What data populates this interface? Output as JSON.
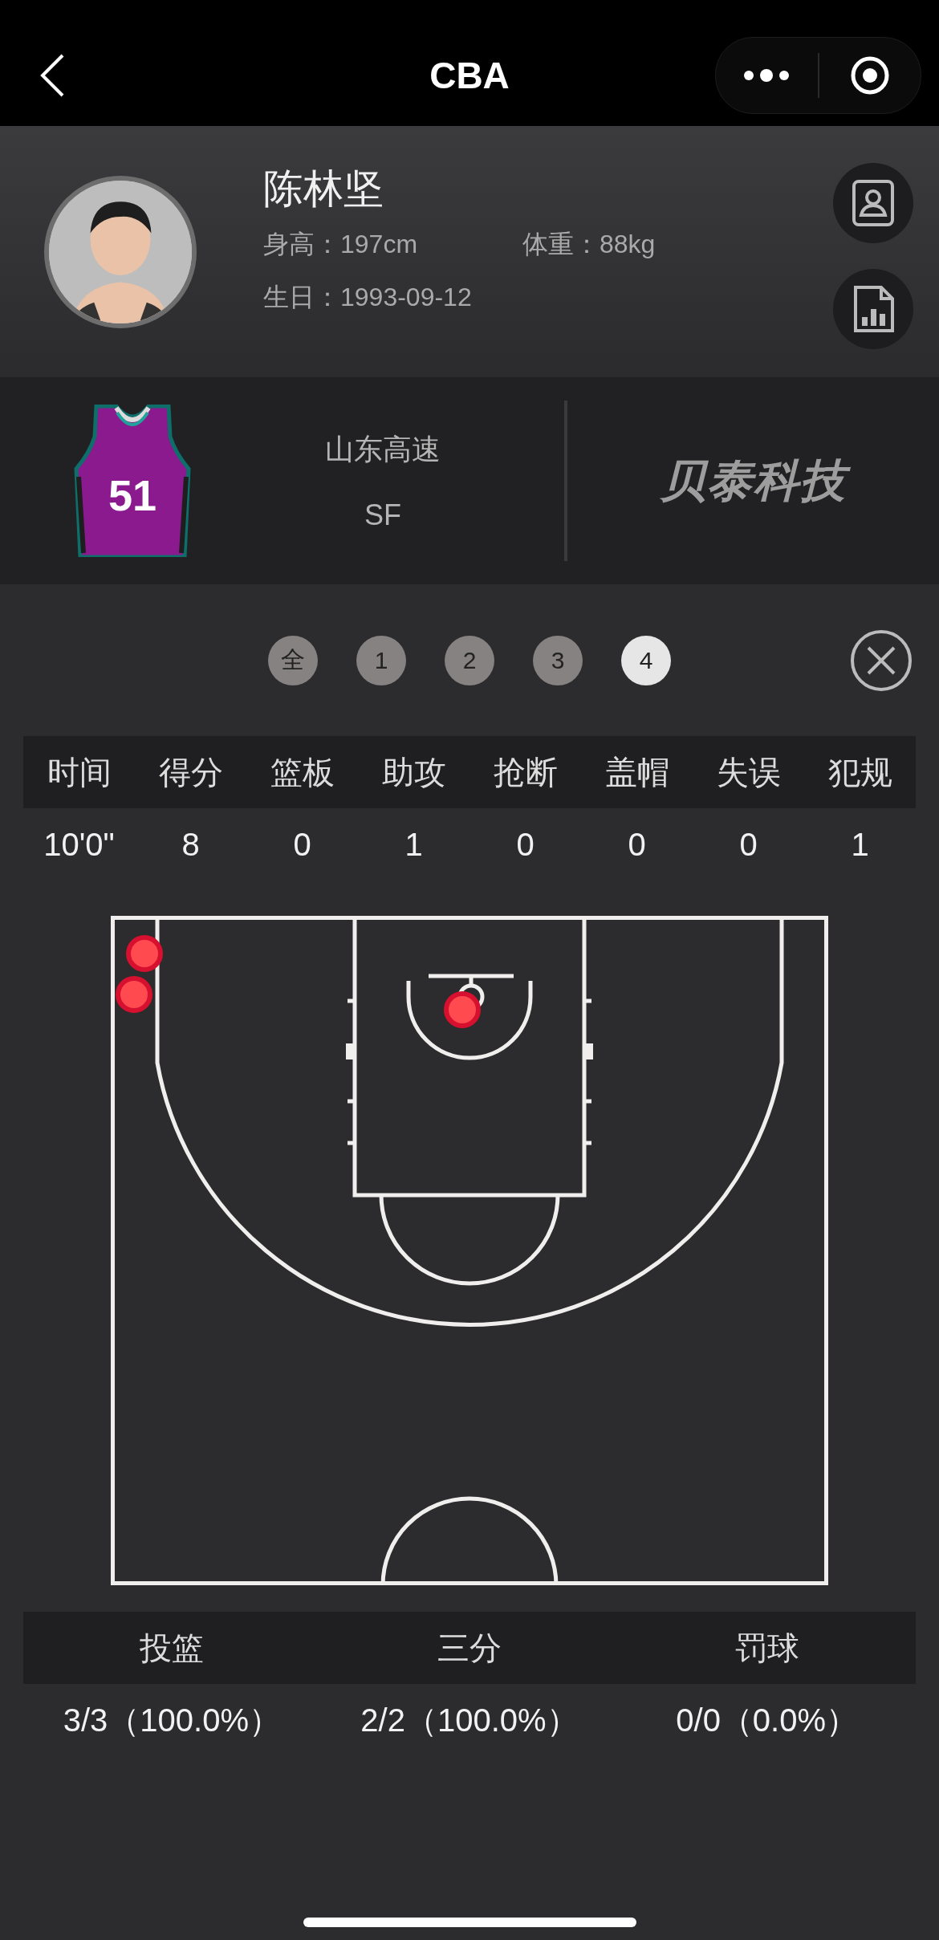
{
  "nav": {
    "title": "CBA"
  },
  "player": {
    "name": "陈林坚",
    "height": "身高：197cm",
    "weight": "体重：88kg",
    "birthday": "生日：1993-09-12"
  },
  "team": {
    "jersey_number": "51",
    "name": "山东高速",
    "position": "SF"
  },
  "sponsor": "贝泰科技",
  "periods": [
    {
      "label": "全",
      "selected": false
    },
    {
      "label": "1",
      "selected": false
    },
    {
      "label": "2",
      "selected": false
    },
    {
      "label": "3",
      "selected": false
    },
    {
      "label": "4",
      "selected": true
    }
  ],
  "stats": {
    "columns": [
      "时间",
      "得分",
      "篮板",
      "助攻",
      "抢断",
      "盖帽",
      "失误",
      "犯规"
    ],
    "values": [
      "10'0\"",
      "8",
      "0",
      "1",
      "0",
      "0",
      "0",
      "1"
    ]
  },
  "shooting": {
    "columns": [
      "投篮",
      "三分",
      "罚球"
    ],
    "values": [
      "3/3（100.0%）",
      "2/2（100.0%）",
      "0/0（0.0%）"
    ]
  }
}
